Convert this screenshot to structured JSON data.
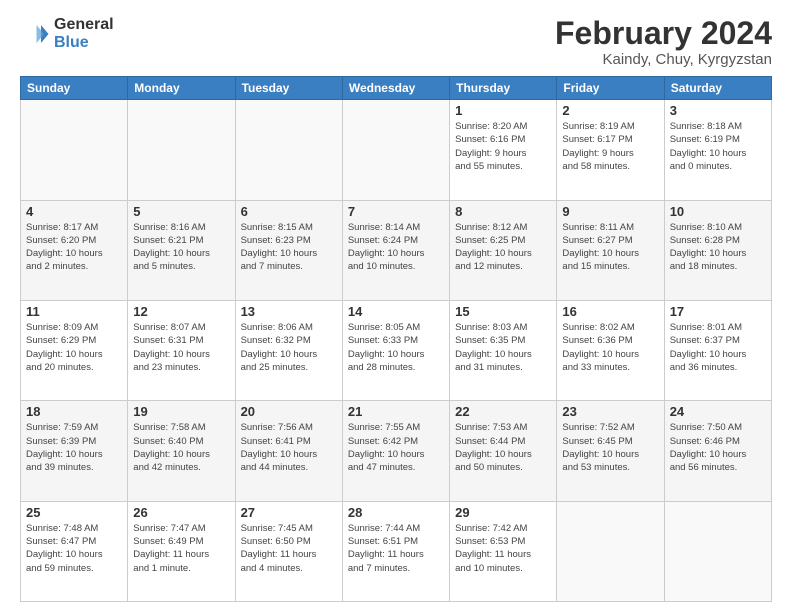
{
  "logo": {
    "general": "General",
    "blue": "Blue"
  },
  "title": "February 2024",
  "subtitle": "Kaindy, Chuy, Kyrgyzstan",
  "days_header": [
    "Sunday",
    "Monday",
    "Tuesday",
    "Wednesday",
    "Thursday",
    "Friday",
    "Saturday"
  ],
  "weeks": [
    [
      {
        "day": "",
        "info": ""
      },
      {
        "day": "",
        "info": ""
      },
      {
        "day": "",
        "info": ""
      },
      {
        "day": "",
        "info": ""
      },
      {
        "day": "1",
        "info": "Sunrise: 8:20 AM\nSunset: 6:16 PM\nDaylight: 9 hours\nand 55 minutes."
      },
      {
        "day": "2",
        "info": "Sunrise: 8:19 AM\nSunset: 6:17 PM\nDaylight: 9 hours\nand 58 minutes."
      },
      {
        "day": "3",
        "info": "Sunrise: 8:18 AM\nSunset: 6:19 PM\nDaylight: 10 hours\nand 0 minutes."
      }
    ],
    [
      {
        "day": "4",
        "info": "Sunrise: 8:17 AM\nSunset: 6:20 PM\nDaylight: 10 hours\nand 2 minutes."
      },
      {
        "day": "5",
        "info": "Sunrise: 8:16 AM\nSunset: 6:21 PM\nDaylight: 10 hours\nand 5 minutes."
      },
      {
        "day": "6",
        "info": "Sunrise: 8:15 AM\nSunset: 6:23 PM\nDaylight: 10 hours\nand 7 minutes."
      },
      {
        "day": "7",
        "info": "Sunrise: 8:14 AM\nSunset: 6:24 PM\nDaylight: 10 hours\nand 10 minutes."
      },
      {
        "day": "8",
        "info": "Sunrise: 8:12 AM\nSunset: 6:25 PM\nDaylight: 10 hours\nand 12 minutes."
      },
      {
        "day": "9",
        "info": "Sunrise: 8:11 AM\nSunset: 6:27 PM\nDaylight: 10 hours\nand 15 minutes."
      },
      {
        "day": "10",
        "info": "Sunrise: 8:10 AM\nSunset: 6:28 PM\nDaylight: 10 hours\nand 18 minutes."
      }
    ],
    [
      {
        "day": "11",
        "info": "Sunrise: 8:09 AM\nSunset: 6:29 PM\nDaylight: 10 hours\nand 20 minutes."
      },
      {
        "day": "12",
        "info": "Sunrise: 8:07 AM\nSunset: 6:31 PM\nDaylight: 10 hours\nand 23 minutes."
      },
      {
        "day": "13",
        "info": "Sunrise: 8:06 AM\nSunset: 6:32 PM\nDaylight: 10 hours\nand 25 minutes."
      },
      {
        "day": "14",
        "info": "Sunrise: 8:05 AM\nSunset: 6:33 PM\nDaylight: 10 hours\nand 28 minutes."
      },
      {
        "day": "15",
        "info": "Sunrise: 8:03 AM\nSunset: 6:35 PM\nDaylight: 10 hours\nand 31 minutes."
      },
      {
        "day": "16",
        "info": "Sunrise: 8:02 AM\nSunset: 6:36 PM\nDaylight: 10 hours\nand 33 minutes."
      },
      {
        "day": "17",
        "info": "Sunrise: 8:01 AM\nSunset: 6:37 PM\nDaylight: 10 hours\nand 36 minutes."
      }
    ],
    [
      {
        "day": "18",
        "info": "Sunrise: 7:59 AM\nSunset: 6:39 PM\nDaylight: 10 hours\nand 39 minutes."
      },
      {
        "day": "19",
        "info": "Sunrise: 7:58 AM\nSunset: 6:40 PM\nDaylight: 10 hours\nand 42 minutes."
      },
      {
        "day": "20",
        "info": "Sunrise: 7:56 AM\nSunset: 6:41 PM\nDaylight: 10 hours\nand 44 minutes."
      },
      {
        "day": "21",
        "info": "Sunrise: 7:55 AM\nSunset: 6:42 PM\nDaylight: 10 hours\nand 47 minutes."
      },
      {
        "day": "22",
        "info": "Sunrise: 7:53 AM\nSunset: 6:44 PM\nDaylight: 10 hours\nand 50 minutes."
      },
      {
        "day": "23",
        "info": "Sunrise: 7:52 AM\nSunset: 6:45 PM\nDaylight: 10 hours\nand 53 minutes."
      },
      {
        "day": "24",
        "info": "Sunrise: 7:50 AM\nSunset: 6:46 PM\nDaylight: 10 hours\nand 56 minutes."
      }
    ],
    [
      {
        "day": "25",
        "info": "Sunrise: 7:48 AM\nSunset: 6:47 PM\nDaylight: 10 hours\nand 59 minutes."
      },
      {
        "day": "26",
        "info": "Sunrise: 7:47 AM\nSunset: 6:49 PM\nDaylight: 11 hours\nand 1 minute."
      },
      {
        "day": "27",
        "info": "Sunrise: 7:45 AM\nSunset: 6:50 PM\nDaylight: 11 hours\nand 4 minutes."
      },
      {
        "day": "28",
        "info": "Sunrise: 7:44 AM\nSunset: 6:51 PM\nDaylight: 11 hours\nand 7 minutes."
      },
      {
        "day": "29",
        "info": "Sunrise: 7:42 AM\nSunset: 6:53 PM\nDaylight: 11 hours\nand 10 minutes."
      },
      {
        "day": "",
        "info": ""
      },
      {
        "day": "",
        "info": ""
      }
    ]
  ]
}
